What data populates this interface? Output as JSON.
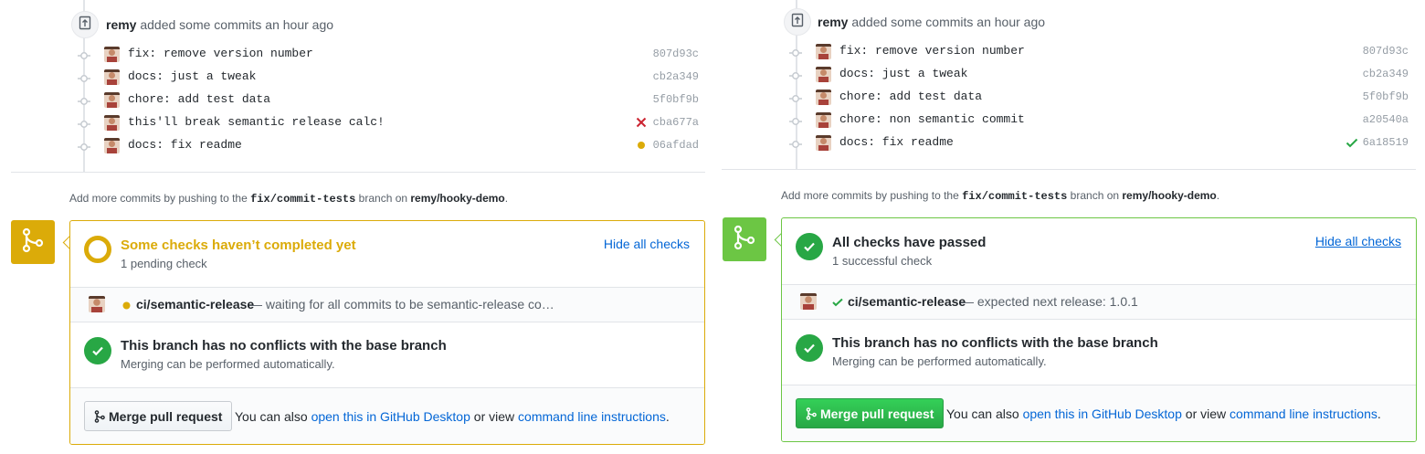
{
  "left": {
    "push": {
      "author": "remy",
      "action": "added some commits an hour ago"
    },
    "commits": [
      {
        "message": "fix: remove version number",
        "sha": "807d93c",
        "status": ""
      },
      {
        "message": "docs: just a tweak",
        "sha": "cb2a349",
        "status": ""
      },
      {
        "message": "chore: add test data",
        "sha": "5f0bf9b",
        "status": ""
      },
      {
        "message": "this'll break semantic release calc!",
        "sha": "cba677a",
        "status": "failure"
      },
      {
        "message": "docs: fix readme",
        "sha": "06afdad",
        "status": "pending"
      }
    ],
    "hint": {
      "prefix": "Add more commits by pushing to the",
      "branch": "fix/commit-tests",
      "middle": "branch on",
      "repo": "remy/hooky-demo",
      "suffix": "."
    },
    "checks": {
      "title": "Some checks haven’t completed yet",
      "subtitle": "1 pending check",
      "hide_label": "Hide all checks",
      "check_name": "ci/semantic-release",
      "check_desc": "— waiting for all commits to be semantic-release compat…",
      "status_color": "#dbab09"
    },
    "conflicts": {
      "title": "This branch has no conflicts with the base branch",
      "subtitle": "Merging can be performed automatically."
    },
    "merge": {
      "button": "Merge pull request",
      "also_prefix": "You can also",
      "desktop_link": "open this in GitHub Desktop",
      "or_view": "or view",
      "cli_link": "command line instructions",
      "period": "."
    }
  },
  "right": {
    "push": {
      "author": "remy",
      "action": "added some commits an hour ago"
    },
    "commits": [
      {
        "message": "fix: remove version number",
        "sha": "807d93c",
        "status": ""
      },
      {
        "message": "docs: just a tweak",
        "sha": "cb2a349",
        "status": ""
      },
      {
        "message": "chore: add test data",
        "sha": "5f0bf9b",
        "status": ""
      },
      {
        "message": "chore: non semantic commit",
        "sha": "a20540a",
        "status": ""
      },
      {
        "message": "docs: fix readme",
        "sha": "6a18519",
        "status": "success"
      }
    ],
    "hint": {
      "prefix": "Add more commits by pushing to the",
      "branch": "fix/commit-tests",
      "middle": "branch on",
      "repo": "remy/hooky-demo",
      "suffix": "."
    },
    "checks": {
      "title": "All checks have passed",
      "subtitle": "1 successful check",
      "hide_label": "Hide all checks",
      "check_name": "ci/semantic-release",
      "check_desc": "— expected next release: 1.0.1",
      "status_color": "#28a745"
    },
    "conflicts": {
      "title": "This branch has no conflicts with the base branch",
      "subtitle": "Merging can be performed automatically."
    },
    "merge": {
      "button": "Merge pull request",
      "also_prefix": "You can also",
      "desktop_link": "open this in GitHub Desktop",
      "or_view": "or view",
      "cli_link": "command line instructions",
      "period": "."
    }
  },
  "colors": {
    "pending": "#dbab09",
    "success": "#28a745",
    "failure": "#cb2431",
    "link": "#0366d6"
  }
}
